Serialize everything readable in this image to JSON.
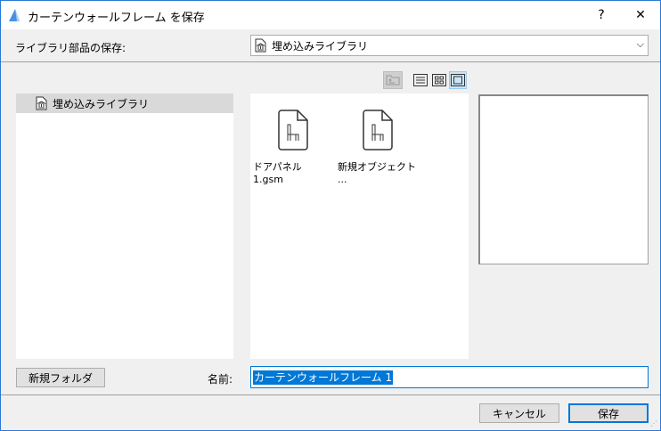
{
  "window": {
    "title": "カーテンウォールフレーム を保存",
    "help": "?",
    "close": "✕",
    "accent": "#0078d7"
  },
  "header": {
    "label": "ライブラリ部品の保存:",
    "location": "埋め込みライブラリ"
  },
  "tree": {
    "items": [
      {
        "label": "埋め込みライブラリ",
        "icon": "library-icon"
      }
    ]
  },
  "files": [
    {
      "name": "ドアパネル 1.gsm",
      "icon": "object-file-icon"
    },
    {
      "name": "新規オブジェクト ...",
      "icon": "object-file-icon"
    }
  ],
  "view_modes": {
    "selected": "large-icons"
  },
  "footer": {
    "new_folder": "新規フォルダ",
    "name_label": "名前:",
    "name_value": "カーテンウォールフレーム 1",
    "cancel": "キャンセル",
    "save": "保存"
  }
}
